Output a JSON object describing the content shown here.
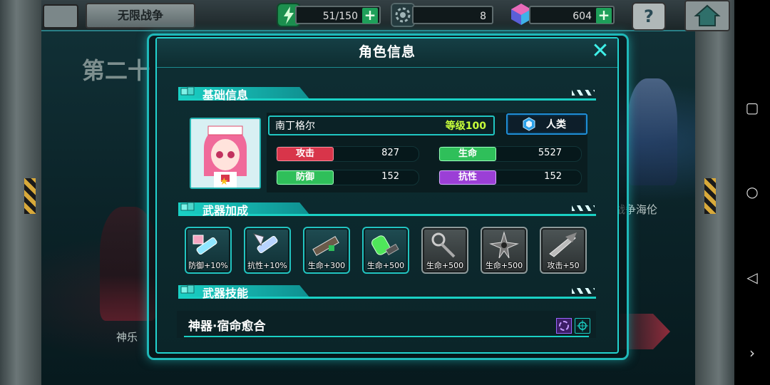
{
  "top_bar": {
    "mode_label": "无限战争",
    "energy": "51/150",
    "gear_count": "8",
    "crystal_count": "604",
    "help": "?"
  },
  "background": {
    "chapter_text": "第二十",
    "left_character": "神乐",
    "right_character": "战争海伦"
  },
  "dialog": {
    "title": "角色信息",
    "sections": {
      "basic": "基础信息",
      "weapon_bonus": "武器加成",
      "weapon_skill": "武器技能"
    },
    "character": {
      "name": "南丁格尔",
      "level": "等级100",
      "race": "人类",
      "stats": [
        {
          "label": "攻击",
          "value": "827",
          "color": "#d8354a"
        },
        {
          "label": "生命",
          "value": "5527",
          "color": "#2fbf5a"
        },
        {
          "label": "防御",
          "value": "152",
          "color": "#2fbf5a"
        },
        {
          "label": "抗性",
          "value": "152",
          "color": "#9b3fd6"
        }
      ]
    },
    "weapons": [
      {
        "label": "防御+10%",
        "style": "teal"
      },
      {
        "label": "抗性+10%",
        "style": "teal"
      },
      {
        "label": "生命+300",
        "style": "teal"
      },
      {
        "label": "生命+500",
        "style": "teal"
      },
      {
        "label": "生命+500",
        "style": "gray"
      },
      {
        "label": "生命+500",
        "style": "gray"
      },
      {
        "label": "攻击+50",
        "style": "gray"
      }
    ],
    "skill": {
      "name": "神器·宿命愈合"
    }
  },
  "colors": {
    "accent": "#1ad0c4",
    "level": "#c8ff3a",
    "race_border": "#1f8fd8"
  }
}
